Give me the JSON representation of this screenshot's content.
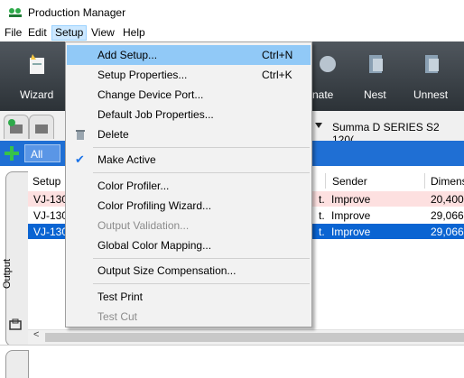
{
  "app": {
    "title": "Production Manager"
  },
  "menubar": {
    "items": [
      "File",
      "Edit",
      "Setup",
      "View",
      "Help"
    ],
    "open_menu": "Setup"
  },
  "toolbar": {
    "labels": [
      "Wizard",
      "nate",
      "Nest",
      "Unnest"
    ]
  },
  "device": {
    "name": "Summa D SERIES S2 120("
  },
  "filter": {
    "all_label": "All"
  },
  "side_tab": {
    "label": "Output"
  },
  "list": {
    "headers": [
      "Setup",
      "Sender",
      "Dimens"
    ],
    "rows": [
      {
        "setup": "VJ-130",
        "mid": "t.",
        "sender": "Improve",
        "dim": "20,400 :",
        "state": "pink"
      },
      {
        "setup": "VJ-130",
        "mid": "t.",
        "sender": "Improve",
        "dim": "29,066 :",
        "state": "normal"
      },
      {
        "setup": "VJ-130",
        "mid": "t.",
        "sender": "Improve",
        "dim": "29,066 :",
        "state": "selected"
      }
    ]
  },
  "setup_menu": {
    "items": [
      {
        "label": "Add Setup...",
        "shortcut": "Ctrl+N",
        "highlighted": true
      },
      {
        "label": "Setup Properties...",
        "shortcut": "Ctrl+K"
      },
      {
        "label": "Change Device Port..."
      },
      {
        "label": "Default Job Properties..."
      },
      {
        "label": "Delete"
      },
      {
        "label": "Make Active",
        "checked": true
      },
      {
        "label": "Color Profiler..."
      },
      {
        "label": "Color Profiling Wizard..."
      },
      {
        "label": "Output Validation...",
        "disabled": true
      },
      {
        "label": "Global Color Mapping..."
      },
      {
        "label": "Output Size Compensation..."
      },
      {
        "label": "Test Print"
      },
      {
        "label": "Test Cut",
        "disabled": true
      }
    ]
  },
  "colors": {
    "accent": "#1f6fd4",
    "selected_row": "#0a64d2",
    "pink_row": "#fde0e0",
    "highlight": "#91c9f7"
  }
}
